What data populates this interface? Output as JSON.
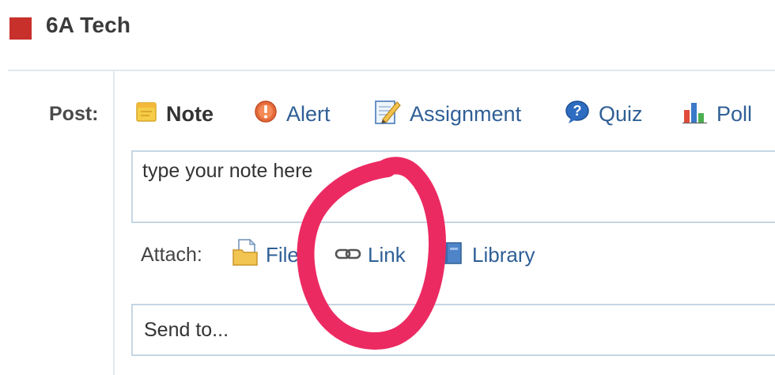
{
  "group": {
    "name": "6A Tech",
    "color": "#c8302c"
  },
  "composer": {
    "post_label": "Post:",
    "post_types": [
      {
        "label": "Note",
        "icon": "note-icon",
        "active": true
      },
      {
        "label": "Alert",
        "icon": "alert-icon",
        "active": false
      },
      {
        "label": "Assignment",
        "icon": "assignment-icon",
        "active": false
      },
      {
        "label": "Quiz",
        "icon": "quiz-icon",
        "active": false
      },
      {
        "label": "Poll",
        "icon": "poll-icon",
        "active": false
      }
    ],
    "note_placeholder": "type your note here",
    "attach_label": "Attach:",
    "attach_items": [
      {
        "label": "File",
        "icon": "file-icon"
      },
      {
        "label": "Link",
        "icon": "link-icon"
      },
      {
        "label": "Library",
        "icon": "library-icon"
      }
    ],
    "send_to_placeholder": "Send to..."
  },
  "annotation": {
    "shape": "hand-drawn circle",
    "color": "#ec2a62",
    "target": "Link"
  },
  "colors": {
    "link": "#2f5f96",
    "border": "#c5d6e3"
  }
}
